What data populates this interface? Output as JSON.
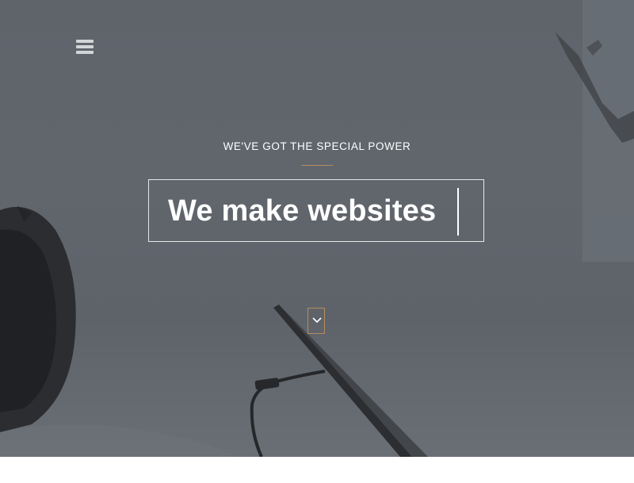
{
  "hero": {
    "tagline": "WE'VE GOT THE SPECIAL POWER",
    "headline": "We make websites",
    "menu_icon": "hamburger-menu-icon",
    "scroll_icon": "chevron-down-icon"
  },
  "colors": {
    "overlay": "#5f646b",
    "accent": "#b58b5e",
    "text": "#ffffff"
  }
}
